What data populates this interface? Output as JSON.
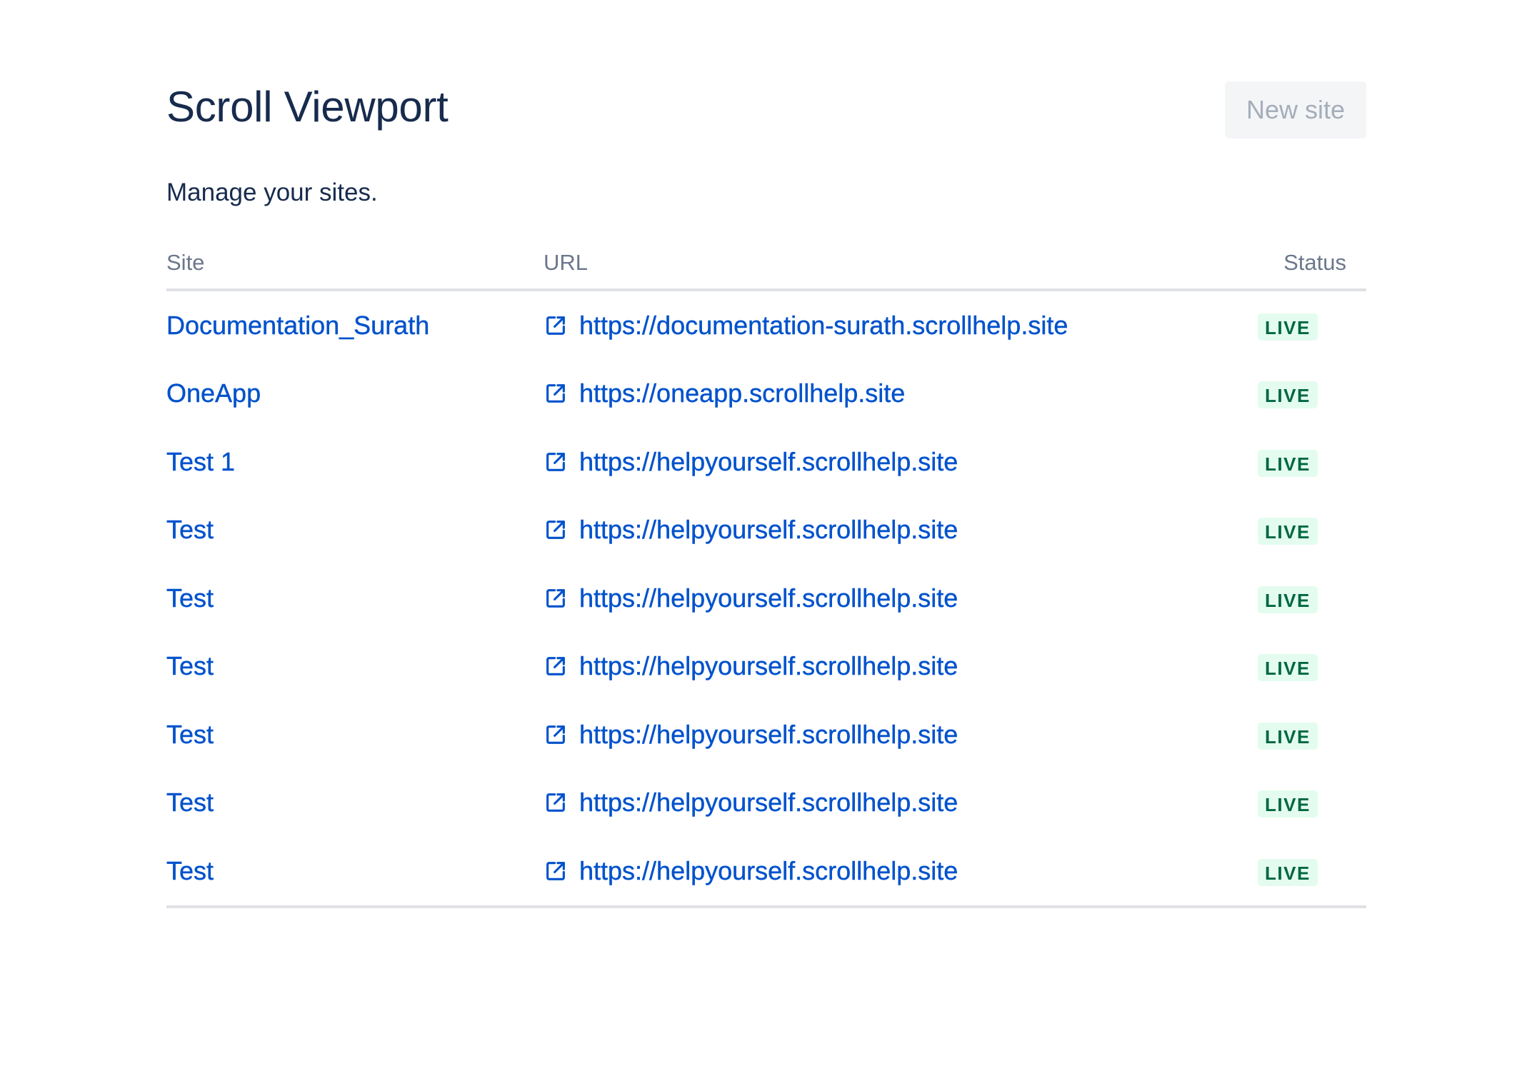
{
  "page": {
    "title": "Scroll Viewport",
    "subtitle": "Manage your sites.",
    "new_site_label": "New site"
  },
  "table": {
    "headers": {
      "site": "Site",
      "url": "URL",
      "status": "Status"
    },
    "rows": [
      {
        "site": "Documentation_Surath",
        "url": "https://documentation-surath.scrollhelp.site",
        "status": "LIVE"
      },
      {
        "site": "OneApp",
        "url": "https://oneapp.scrollhelp.site",
        "status": "LIVE"
      },
      {
        "site": "Test 1",
        "url": "https://helpyourself.scrollhelp.site",
        "status": "LIVE"
      },
      {
        "site": "Test",
        "url": "https://helpyourself.scrollhelp.site",
        "status": "LIVE"
      },
      {
        "site": "Test",
        "url": "https://helpyourself.scrollhelp.site",
        "status": "LIVE"
      },
      {
        "site": "Test",
        "url": "https://helpyourself.scrollhelp.site",
        "status": "LIVE"
      },
      {
        "site": "Test",
        "url": "https://helpyourself.scrollhelp.site",
        "status": "LIVE"
      },
      {
        "site": "Test",
        "url": "https://helpyourself.scrollhelp.site",
        "status": "LIVE"
      },
      {
        "site": "Test",
        "url": "https://helpyourself.scrollhelp.site",
        "status": "LIVE"
      }
    ]
  },
  "icons": {
    "url_icon": "external-link-icon"
  },
  "colors": {
    "link": "#0052cc",
    "title": "#172b4d",
    "header_text": "#6b778c",
    "button_bg": "#f4f5f7",
    "button_text": "#a5adba",
    "badge_bg": "#e3fcef",
    "badge_text": "#006644",
    "divider": "#dfe1e6"
  }
}
